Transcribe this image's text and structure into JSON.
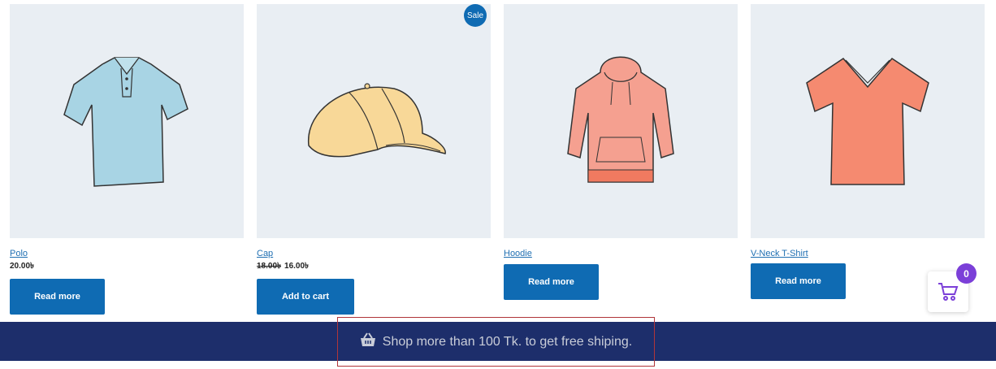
{
  "products": [
    {
      "name": "Polo",
      "price": "20.00৳",
      "old_price": "",
      "button": "Read more",
      "sale": ""
    },
    {
      "name": "Cap",
      "price": "16.00৳",
      "old_price": "18.00৳",
      "button": "Add to cart",
      "sale": "Sale"
    },
    {
      "name": "Hoodie",
      "price": "",
      "old_price": "",
      "button": "Read more",
      "sale": ""
    },
    {
      "name": "V-Neck T-Shirt",
      "price": "",
      "old_price": "",
      "button": "Read more",
      "sale": ""
    }
  ],
  "shipping_notice": {
    "icon": "basket-icon",
    "text": "Shop more than 100 Tk. to get free shiping."
  },
  "cart": {
    "icon": "cart-icon",
    "count": "0"
  },
  "colors": {
    "button": "#0f6bb3",
    "banner": "#1d2e6b",
    "badge": "#7b3fd8"
  }
}
